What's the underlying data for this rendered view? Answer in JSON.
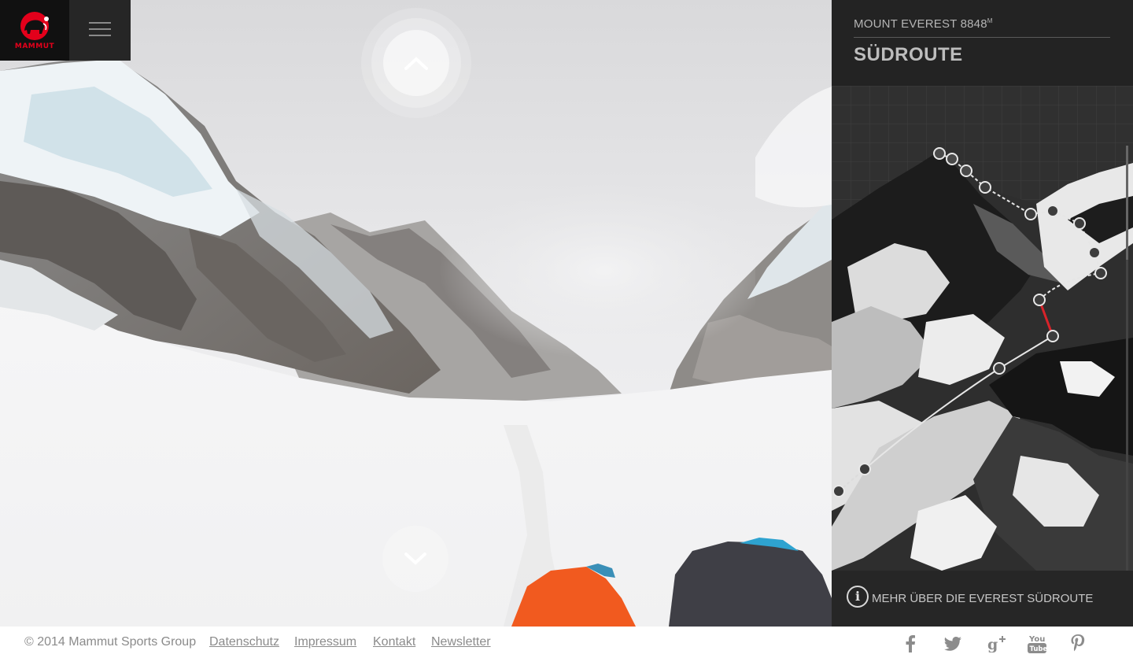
{
  "brand": {
    "logo_text": "MAMMUT"
  },
  "menu": {
    "icon": "hamburger-icon"
  },
  "navigation": {
    "up_icon": "chevron-up-icon",
    "down_icon": "chevron-down-icon"
  },
  "panel": {
    "subtitle": "MOUNT EVEREST 8848",
    "subtitle_unit": "M",
    "title": "SÜDROUTE",
    "info_icon": "info-icon",
    "info_text": "MEHR ÜBER DIE EVEREST SÜDROUTE"
  },
  "footer": {
    "copyright": "© 2014 Mammut Sports Group",
    "links": [
      "Datenschutz",
      "Impressum",
      "Kontakt",
      "Newsletter"
    ],
    "social": [
      {
        "name": "facebook-icon",
        "glyph": "f"
      },
      {
        "name": "twitter-icon",
        "glyph": "t"
      },
      {
        "name": "google-plus-icon",
        "glyph": "g+"
      },
      {
        "name": "youtube-icon",
        "glyph": "You Tube"
      },
      {
        "name": "pinterest-icon",
        "glyph": "p"
      }
    ]
  },
  "colors": {
    "brand_red": "#e3001b",
    "panel_bg": "#2b2b2b",
    "route_active": "#d8232a",
    "jacket_orange": "#f15a1f"
  }
}
